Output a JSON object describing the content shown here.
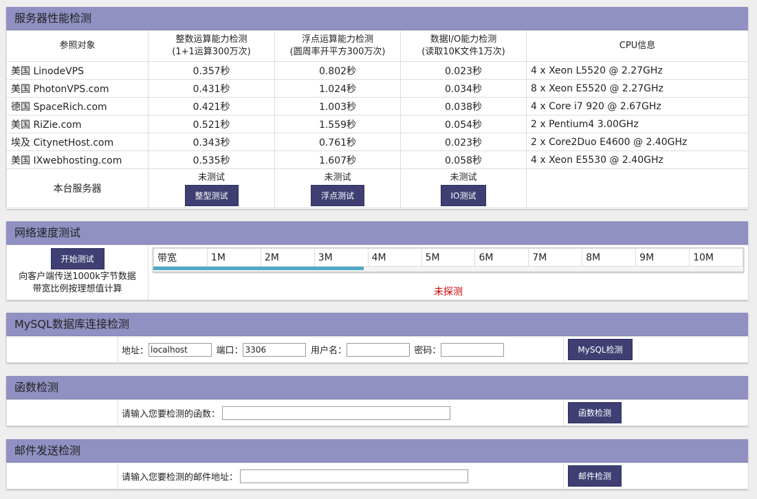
{
  "perf": {
    "title": "服务器性能检测",
    "headers": {
      "ref": "参照对象",
      "int_l1": "整数运算能力检测",
      "int_l2": "(1+1运算300万次)",
      "float_l1": "浮点运算能力检测",
      "float_l2": "(圆周率开平方300万次)",
      "io_l1": "数据I/O能力检测",
      "io_l2": "(读取10K文件1万次)",
      "cpu": "CPU信息"
    },
    "rows": [
      {
        "name": "美国 LinodeVPS",
        "int": "0.357秒",
        "float": "0.802秒",
        "io": "0.023秒",
        "cpu": "4 x Xeon L5520 @ 2.27GHz"
      },
      {
        "name": "美国 PhotonVPS.com",
        "int": "0.431秒",
        "float": "1.024秒",
        "io": "0.034秒",
        "cpu": "8 x Xeon E5520 @ 2.27GHz"
      },
      {
        "name": "德国 SpaceRich.com",
        "int": "0.421秒",
        "float": "1.003秒",
        "io": "0.038秒",
        "cpu": "4 x Core i7 920 @ 2.67GHz"
      },
      {
        "name": "美国 RiZie.com",
        "int": "0.521秒",
        "float": "1.559秒",
        "io": "0.054秒",
        "cpu": "2 x Pentium4 3.00GHz"
      },
      {
        "name": "埃及 CitynetHost.com",
        "int": "0.343秒",
        "float": "0.761秒",
        "io": "0.023秒",
        "cpu": "2 x Core2Duo E4600 @ 2.40GHz"
      },
      {
        "name": "美国 IXwebhosting.com",
        "int": "0.535秒",
        "float": "1.607秒",
        "io": "0.058秒",
        "cpu": "4 x Xeon E5530 @ 2.40GHz"
      }
    ],
    "local": {
      "name": "本台服务器",
      "untested": "未测试",
      "int_btn": "整型测试",
      "float_btn": "浮点测试",
      "io_btn": "IO测试"
    }
  },
  "net": {
    "title": "网络速度测试",
    "start_btn": "开始测试",
    "desc1": "向客户端传送1000k字节数据",
    "desc2": "带宽比例按理想值计算",
    "bw_label": "带宽",
    "bw_ticks": [
      "1M",
      "2M",
      "3M",
      "4M",
      "5M",
      "6M",
      "7M",
      "8M",
      "9M",
      "10M"
    ],
    "progress_fraction": 0.357,
    "status": "未探测",
    "status_color": "#cc0000",
    "progress_color": "#4fa8c8"
  },
  "mysql": {
    "title": "MySQL数据库连接检测",
    "addr_label": "地址：",
    "addr_value": "localhost",
    "port_label": "端口：",
    "port_value": "3306",
    "user_label": "用户名：",
    "user_value": "",
    "pass_label": "密码：",
    "pass_value": "",
    "btn": "MySQL检测"
  },
  "func": {
    "title": "函数检测",
    "prompt": "请输入您要检测的函数：",
    "value": "",
    "btn": "函数检测"
  },
  "mail": {
    "title": "邮件发送检测",
    "prompt": "请输入您要检测的邮件地址：",
    "value": "",
    "btn": "邮件检测"
  },
  "colors": {
    "header_bg": "#9090c2",
    "button_bg": "#3f3f73"
  }
}
